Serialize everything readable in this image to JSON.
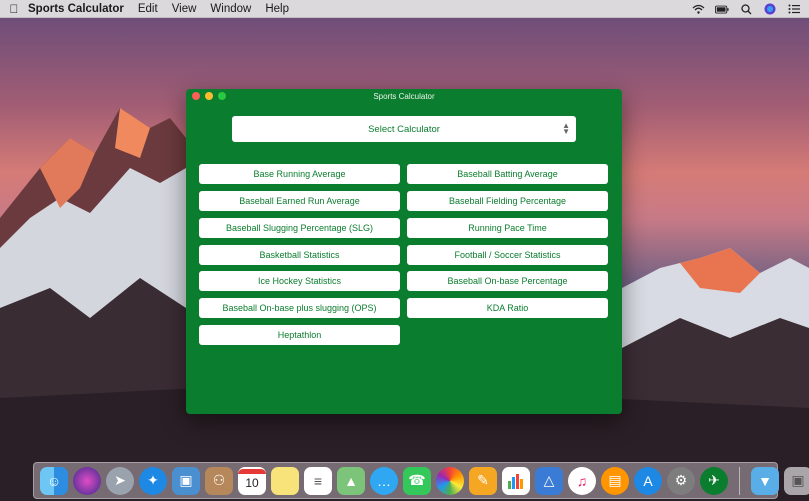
{
  "menubar": {
    "app_name": "Sports Calculator",
    "menus": [
      "Edit",
      "View",
      "Window",
      "Help"
    ]
  },
  "window": {
    "title": "Sports Calculator",
    "select_label": "Select Calculator",
    "buttons_left": [
      "Base Running Average",
      "Baseball Earned Run Average",
      "Baseball Slugging Percentage (SLG)",
      "Basketball Statistics",
      "Ice Hockey Statistics",
      "Baseball On-base plus slugging (OPS)",
      "Heptathlon"
    ],
    "buttons_right": [
      "Baseball Batting Average",
      "Baseball Fielding Percentage",
      "Running Pace Time",
      "Football / Soccer Statistics",
      "Baseball On-base Percentage",
      "KDA Ratio"
    ]
  },
  "colors": {
    "window_bg": "#0b7d2e",
    "button_bg": "#ffffff",
    "button_text": "#0b7d2e"
  },
  "dock": {
    "calendar_day": "10",
    "icons": [
      "finder-icon",
      "siri-icon",
      "launchpad-icon",
      "safari-icon",
      "preview-icon",
      "contacts-icon",
      "calendar-icon",
      "notes-icon",
      "reminders-icon",
      "maps-icon",
      "messages-icon",
      "facetime-icon",
      "photos-icon",
      "pages-icon",
      "numbers-icon",
      "keynote-icon",
      "itunes-icon",
      "ibooks-icon",
      "app-store-icon",
      "system-preferences-icon",
      "sports-calculator-icon",
      "downloads-folder-icon",
      "trash-icon"
    ]
  }
}
